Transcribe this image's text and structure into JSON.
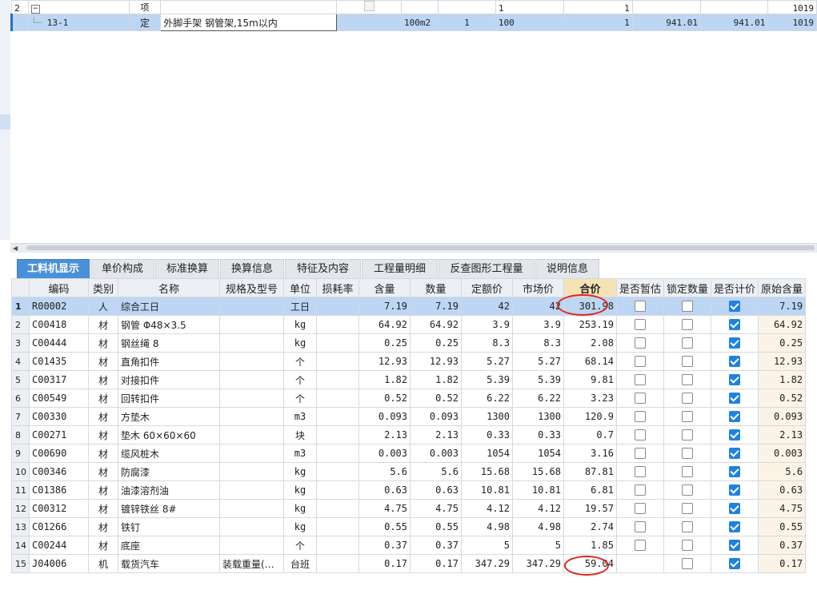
{
  "top_grid": {
    "row1": {
      "num": "2",
      "expand": "−",
      "type": "项",
      "v1": "1",
      "v2": "1",
      "v3": "1019"
    },
    "row2": {
      "code": "13-1",
      "type": "定",
      "name": "外脚手架 钢管架,15m以内",
      "unit": "100m2",
      "qty": "1",
      "v1": "100",
      "v2": "1",
      "p1": "941.01",
      "p2": "941.01",
      "v3": "1019"
    }
  },
  "tabs": [
    "工料机显示",
    "单价构成",
    "标准换算",
    "换算信息",
    "特征及内容",
    "工程量明细",
    "反查图形工程量",
    "说明信息"
  ],
  "columns": [
    "编码",
    "类别",
    "名称",
    "规格及型号",
    "单位",
    "损耗率",
    "含量",
    "数量",
    "定额价",
    "市场价",
    "合价",
    "是否暂估",
    "锁定数量",
    "是否计价",
    "原始含量"
  ],
  "rows": [
    {
      "n": "1",
      "code": "R00002",
      "cat": "人",
      "name": "综合工日",
      "spec": "",
      "unit": "工日",
      "loss": "",
      "content": "7.19",
      "qty": "7.19",
      "quota": "42",
      "market": "42",
      "total": "301.98",
      "est": false,
      "lock": false,
      "priced": true,
      "orig": "7.19"
    },
    {
      "n": "2",
      "code": "C00418",
      "cat": "材",
      "name": "钢管 Φ48×3.5",
      "spec": "",
      "unit": "kg",
      "loss": "",
      "content": "64.92",
      "qty": "64.92",
      "quota": "3.9",
      "market": "3.9",
      "total": "253.19",
      "est": false,
      "lock": false,
      "priced": true,
      "orig": "64.92"
    },
    {
      "n": "3",
      "code": "C00444",
      "cat": "材",
      "name": "钢丝绳 8",
      "spec": "",
      "unit": "kg",
      "loss": "",
      "content": "0.25",
      "qty": "0.25",
      "quota": "8.3",
      "market": "8.3",
      "total": "2.08",
      "est": false,
      "lock": false,
      "priced": true,
      "orig": "0.25"
    },
    {
      "n": "4",
      "code": "C01435",
      "cat": "材",
      "name": "直角扣件",
      "spec": "",
      "unit": "个",
      "loss": "",
      "content": "12.93",
      "qty": "12.93",
      "quota": "5.27",
      "market": "5.27",
      "total": "68.14",
      "est": false,
      "lock": false,
      "priced": true,
      "orig": "12.93"
    },
    {
      "n": "5",
      "code": "C00317",
      "cat": "材",
      "name": "对接扣件",
      "spec": "",
      "unit": "个",
      "loss": "",
      "content": "1.82",
      "qty": "1.82",
      "quota": "5.39",
      "market": "5.39",
      "total": "9.81",
      "est": false,
      "lock": false,
      "priced": true,
      "orig": "1.82"
    },
    {
      "n": "6",
      "code": "C00549",
      "cat": "材",
      "name": "回转扣件",
      "spec": "",
      "unit": "个",
      "loss": "",
      "content": "0.52",
      "qty": "0.52",
      "quota": "6.22",
      "market": "6.22",
      "total": "3.23",
      "est": false,
      "lock": false,
      "priced": true,
      "orig": "0.52"
    },
    {
      "n": "7",
      "code": "C00330",
      "cat": "材",
      "name": "方垫木",
      "spec": "",
      "unit": "m3",
      "loss": "",
      "content": "0.093",
      "qty": "0.093",
      "quota": "1300",
      "market": "1300",
      "total": "120.9",
      "est": false,
      "lock": false,
      "priced": true,
      "orig": "0.093"
    },
    {
      "n": "8",
      "code": "C00271",
      "cat": "材",
      "name": "垫木 60×60×60",
      "spec": "",
      "unit": "块",
      "loss": "",
      "content": "2.13",
      "qty": "2.13",
      "quota": "0.33",
      "market": "0.33",
      "total": "0.7",
      "est": false,
      "lock": false,
      "priced": true,
      "orig": "2.13"
    },
    {
      "n": "9",
      "code": "C00690",
      "cat": "材",
      "name": "缆风桩木",
      "spec": "",
      "unit": "m3",
      "loss": "",
      "content": "0.003",
      "qty": "0.003",
      "quota": "1054",
      "market": "1054",
      "total": "3.16",
      "est": false,
      "lock": false,
      "priced": true,
      "orig": "0.003"
    },
    {
      "n": "10",
      "code": "C00346",
      "cat": "材",
      "name": "防腐漆",
      "spec": "",
      "unit": "kg",
      "loss": "",
      "content": "5.6",
      "qty": "5.6",
      "quota": "15.68",
      "market": "15.68",
      "total": "87.81",
      "est": false,
      "lock": false,
      "priced": true,
      "orig": "5.6"
    },
    {
      "n": "11",
      "code": "C01386",
      "cat": "材",
      "name": "油漆溶剂油",
      "spec": "",
      "unit": "kg",
      "loss": "",
      "content": "0.63",
      "qty": "0.63",
      "quota": "10.81",
      "market": "10.81",
      "total": "6.81",
      "est": false,
      "lock": false,
      "priced": true,
      "orig": "0.63"
    },
    {
      "n": "12",
      "code": "C00312",
      "cat": "材",
      "name": "镀锌铁丝 8#",
      "spec": "",
      "unit": "kg",
      "loss": "",
      "content": "4.75",
      "qty": "4.75",
      "quota": "4.12",
      "market": "4.12",
      "total": "19.57",
      "est": false,
      "lock": false,
      "priced": true,
      "orig": "4.75"
    },
    {
      "n": "13",
      "code": "C01266",
      "cat": "材",
      "name": "铁钉",
      "spec": "",
      "unit": "kg",
      "loss": "",
      "content": "0.55",
      "qty": "0.55",
      "quota": "4.98",
      "market": "4.98",
      "total": "2.74",
      "est": false,
      "lock": false,
      "priced": true,
      "orig": "0.55"
    },
    {
      "n": "14",
      "code": "C00244",
      "cat": "材",
      "name": "底座",
      "spec": "",
      "unit": "个",
      "loss": "",
      "content": "0.37",
      "qty": "0.37",
      "quota": "5",
      "market": "5",
      "total": "1.85",
      "est": false,
      "lock": false,
      "priced": true,
      "orig": "0.37"
    },
    {
      "n": "15",
      "code": "J04006",
      "cat": "机",
      "name": "载货汽车",
      "spec": "装载重量(…",
      "unit": "台班",
      "loss": "",
      "content": "0.17",
      "qty": "0.17",
      "quota": "347.29",
      "market": "347.29",
      "total": "59.04",
      "est": null,
      "lock": false,
      "priced": true,
      "orig": "0.17"
    }
  ],
  "colors": {
    "accent": "#4a90d9",
    "selection": "#bcd6f3",
    "annotation": "#e0241b",
    "checked": "#1e82e0"
  }
}
